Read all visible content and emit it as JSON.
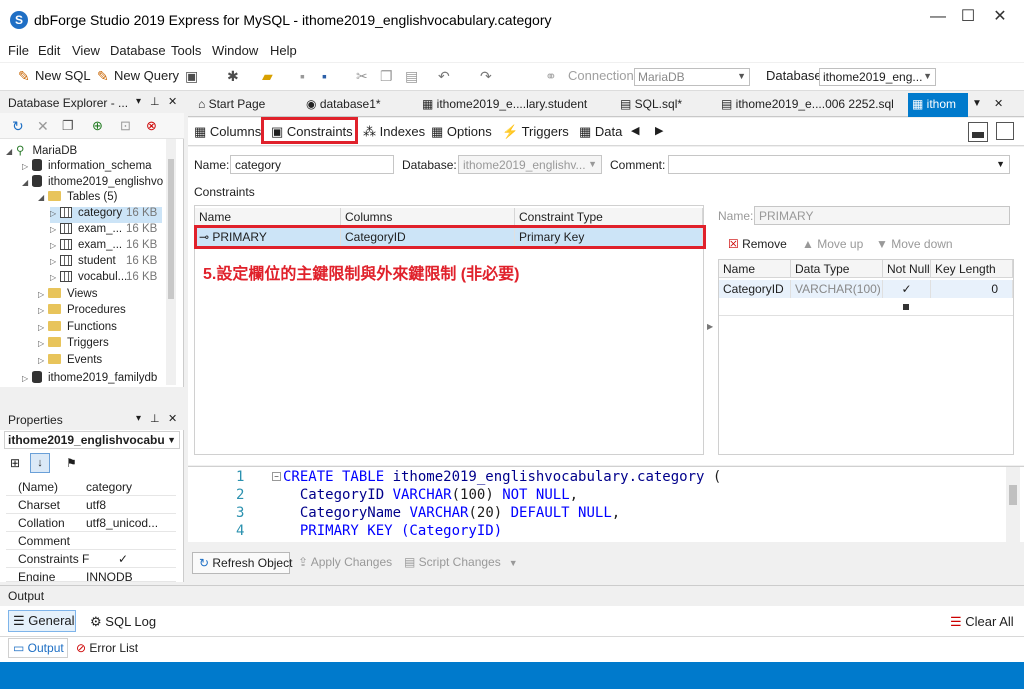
{
  "app": {
    "title": "dbForge Studio 2019 Express for MySQL - ithome2019_englishvocabulary.category"
  },
  "menu": [
    "File",
    "Edit",
    "View",
    "Database",
    "Tools",
    "Window",
    "Help"
  ],
  "toolbar": {
    "new_sql": "New SQL",
    "new_query": "New Query",
    "connection_label": "Connection",
    "connection_value": "MariaDB",
    "database_label": "Database",
    "database_value": "ithome2019_eng..."
  },
  "explorer": {
    "title": "Database Explorer - ...",
    "tree": [
      {
        "label": "MariaDB"
      },
      {
        "label": "information_schema"
      },
      {
        "label": "ithome2019_englishvo"
      },
      {
        "label": "Tables (5)"
      },
      {
        "label": "category",
        "size": "16 KB"
      },
      {
        "label": "exam_...",
        "size": "16 KB"
      },
      {
        "label": "exam_...",
        "size": "16 KB"
      },
      {
        "label": "student",
        "size": "16 KB"
      },
      {
        "label": "vocabul...",
        "size": "16 KB"
      },
      {
        "label": "Views"
      },
      {
        "label": "Procedures"
      },
      {
        "label": "Functions"
      },
      {
        "label": "Triggers"
      },
      {
        "label": "Events"
      },
      {
        "label": "ithome2019_familydb"
      }
    ]
  },
  "properties": {
    "title": "Properties",
    "object": "ithome2019_englishvocabu",
    "rows": [
      {
        "k": "(Name)",
        "v": "category"
      },
      {
        "k": "Charset",
        "v": "utf8"
      },
      {
        "k": "Collation",
        "v": "utf8_unicod..."
      },
      {
        "k": "Comment",
        "v": ""
      },
      {
        "k": "Constraints F",
        "v": "✓"
      },
      {
        "k": "Engine",
        "v": "INNODB"
      }
    ]
  },
  "doc_tabs": [
    "Start Page",
    "database1*",
    "ithome2019_e....lary.student",
    "SQL.sql*",
    "ithome2019_e....006 2252.sql",
    "ithom"
  ],
  "subtabs": [
    "Columns",
    "Constraints",
    "Indexes",
    "Options",
    "Triggers",
    "Data"
  ],
  "editor": {
    "name_label": "Name:",
    "name_value": "category",
    "database_label": "Database:",
    "database_value": "ithome2019_englishv...",
    "comment_label": "Comment:",
    "section": "Constraints",
    "headers": [
      "Name",
      "Columns",
      "Constraint Type"
    ],
    "row": {
      "name": "PRIMARY",
      "columns": "CategoryID",
      "type": "Primary Key"
    },
    "annotation": "5.設定欄位的主鍵限制與外來鍵限制 (非必要)"
  },
  "detail": {
    "name_label": "Name:",
    "name_value": "PRIMARY",
    "remove": "Remove",
    "move_up": "Move up",
    "move_down": "Move down",
    "headers": [
      "Name",
      "Data Type",
      "Not Null",
      "Key Length"
    ],
    "row": {
      "name": "CategoryID",
      "type": "VARCHAR(100)",
      "notnull": "✓",
      "keylen": "0"
    }
  },
  "code": {
    "lines": [
      "1",
      "2",
      "3",
      "4"
    ],
    "l1a": "CREATE TABLE ",
    "l1b": "ithome2019_englishvocabulary.category",
    "l1c": " (",
    "l2a": "  CategoryID ",
    "l2b": "VARCHAR",
    "l2c": "(",
    "l2d": "100",
    "l2e": ") ",
    "l2f": "NOT NULL",
    "l2g": ",",
    "l3a": "  CategoryName ",
    "l3b": "VARCHAR",
    "l3c": "(",
    "l3d": "20",
    "l3e": ") ",
    "l3f": "DEFAULT NULL",
    "l3g": ",",
    "l4": "  PRIMARY KEY (CategoryID)"
  },
  "bottom": {
    "refresh": "Refresh Object",
    "apply": "Apply Changes",
    "script": "Script Changes"
  },
  "output": {
    "title": "Output",
    "general": "General",
    "sql_log": "SQL Log",
    "clear_all": "Clear All",
    "tab_output": "Output",
    "tab_errors": "Error List"
  }
}
